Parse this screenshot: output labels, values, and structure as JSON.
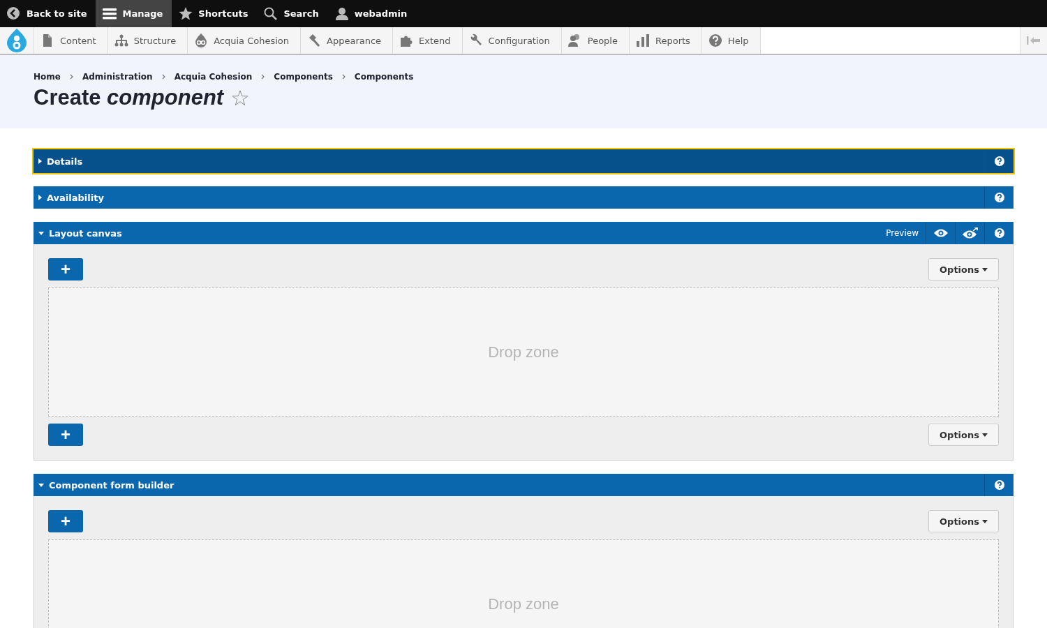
{
  "toolbar": {
    "items": [
      {
        "label": "Back to site",
        "selected": false
      },
      {
        "label": "Manage",
        "selected": true
      },
      {
        "label": "Shortcuts",
        "selected": false
      },
      {
        "label": "Search",
        "selected": false
      },
      {
        "label": "webadmin",
        "selected": false
      }
    ]
  },
  "menu": {
    "items": [
      {
        "label": "Content"
      },
      {
        "label": "Structure"
      },
      {
        "label": "Acquia Cohesion"
      },
      {
        "label": "Appearance"
      },
      {
        "label": "Extend"
      },
      {
        "label": "Configuration"
      },
      {
        "label": "People"
      },
      {
        "label": "Reports"
      },
      {
        "label": "Help"
      }
    ]
  },
  "breadcrumb": [
    "Home",
    "Administration",
    "Acquia Cohesion",
    "Components",
    "Components"
  ],
  "page_title": "Create *component*",
  "sections": [
    {
      "title": "Details",
      "expanded": false,
      "focused": true
    },
    {
      "title": "Availability",
      "expanded": false,
      "focused": false
    },
    {
      "title": "Layout canvas",
      "expanded": true,
      "focused": false,
      "preview": "Preview",
      "body": [
        {
          "kind": "controls",
          "add": "+",
          "options": "Options"
        },
        {
          "kind": "dropzone",
          "label": "Drop zone"
        },
        {
          "kind": "controls",
          "add": "+",
          "options": "Options"
        }
      ]
    },
    {
      "title": "Component form builder",
      "expanded": true,
      "focused": false,
      "body": [
        {
          "kind": "controls",
          "add": "+",
          "options": "Options"
        },
        {
          "kind": "dropzone",
          "label": "Drop zone"
        }
      ]
    }
  ]
}
